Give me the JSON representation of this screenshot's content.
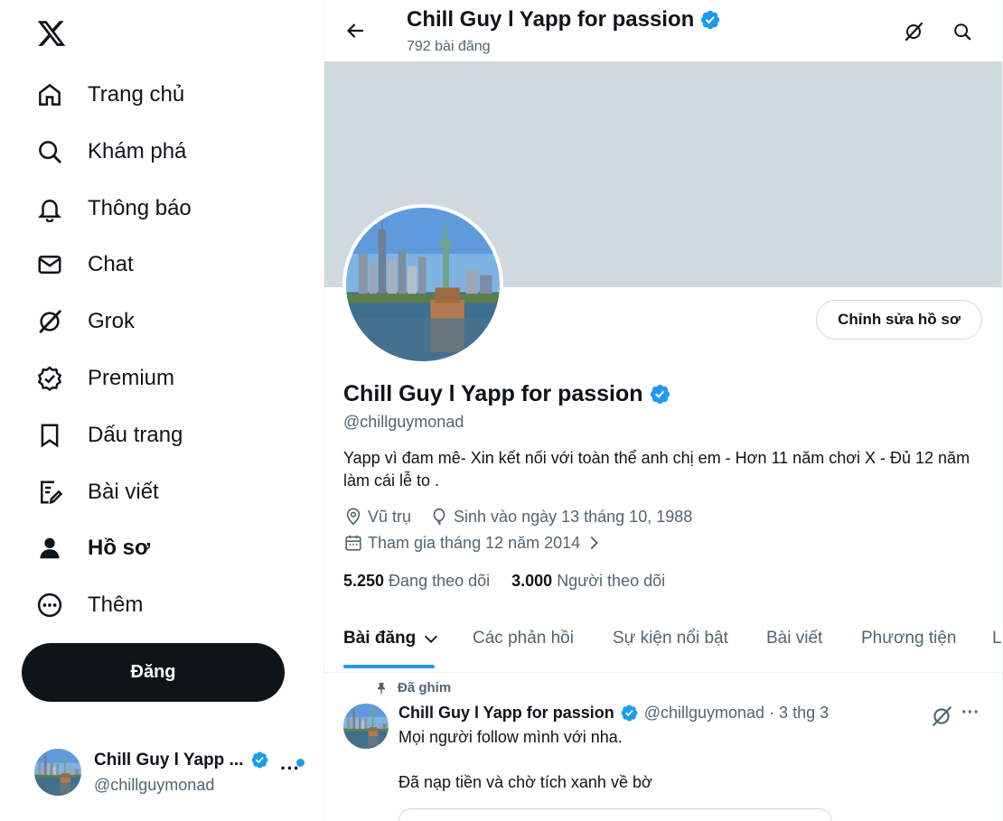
{
  "sidebar": {
    "items": [
      {
        "label": "Trang chủ",
        "icon": "home-icon"
      },
      {
        "label": "Khám phá",
        "icon": "search-icon"
      },
      {
        "label": "Thông báo",
        "icon": "bell-icon"
      },
      {
        "label": "Chat",
        "icon": "mail-icon"
      },
      {
        "label": "Grok",
        "icon": "grok-icon"
      },
      {
        "label": "Premium",
        "icon": "premium-icon"
      },
      {
        "label": "Dấu trang",
        "icon": "bookmark-icon"
      },
      {
        "label": "Bài viết",
        "icon": "article-icon"
      },
      {
        "label": "Hồ sơ",
        "icon": "profile-icon"
      },
      {
        "label": "Thêm",
        "icon": "more-circle-icon"
      }
    ],
    "post_label": "Đăng",
    "account": {
      "name": "Chill Guy l Yapp ...",
      "handle": "@chillguymonad",
      "more": "···"
    }
  },
  "header": {
    "title": "Chill Guy l Yapp for passion",
    "post_count": "792 bài đăng"
  },
  "profile": {
    "edit_label": "Chỉnh sửa hồ sơ",
    "name": "Chill Guy l Yapp for passion",
    "handle": "@chillguymonad",
    "bio": "Yapp vì đam mê- Xin kết nối với toàn thể anh chị em - Hơn 11 năm chơi X - Đủ 12 năm làm cái lễ to .",
    "location": "Vũ trụ",
    "birthday": "Sinh vào ngày 13 tháng 10, 1988",
    "joined": "Tham gia tháng 12 năm 2014",
    "following_count": "5.250",
    "following_label": "Đang theo dõi",
    "followers_count": "3.000",
    "followers_label": "Người theo dõi"
  },
  "tabs": [
    {
      "label": "Bài đăng"
    },
    {
      "label": "Các phản hồi"
    },
    {
      "label": "Sự kiện nổi bật"
    },
    {
      "label": "Bài viết"
    },
    {
      "label": "Phương tiện"
    },
    {
      "label": "L"
    }
  ],
  "tweet": {
    "pinned_label": "Đã ghim",
    "name": "Chill Guy l Yapp for passion",
    "handle_time": "@chillguymonad · 3 thg 3",
    "more": "···",
    "line1": "Mọi người follow mình với nha.",
    "line2": "Đã nạp tiền và chờ tích xanh về bờ"
  },
  "colors": {
    "accent": "#1d9bf0",
    "text": "#0f1419",
    "muted": "#536471",
    "banner": "#cfd9de"
  }
}
